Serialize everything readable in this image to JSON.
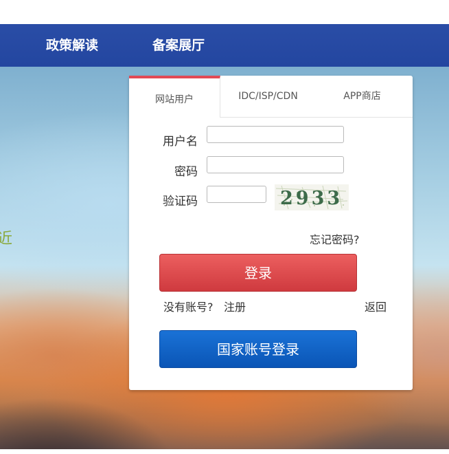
{
  "nav": {
    "items": [
      {
        "label": "政策解读"
      },
      {
        "label": "备案展厅"
      }
    ],
    "color": "#2346a0"
  },
  "hero": {
    "side_text": "近",
    "side_text_color": "#8aa93c"
  },
  "login": {
    "tabs": [
      {
        "label": "网站用户",
        "active": true
      },
      {
        "label": "IDC/ISP/CDN",
        "active": false
      },
      {
        "label": "APP商店",
        "active": false
      }
    ],
    "active_tab_color": "#e14a55",
    "username_label": "用户名",
    "username_value": "",
    "password_label": "密码",
    "password_value": "",
    "captcha_label": "验证码",
    "captcha_value": "",
    "captcha_text": "2933",
    "forgot_password": "忘记密码?",
    "login_button": "登录",
    "login_button_color": "#d9434a",
    "no_account": "没有账号?",
    "register": "注册",
    "back": "返回",
    "national_login_button": "国家账号登录",
    "national_button_color": "#0b5fc6"
  }
}
